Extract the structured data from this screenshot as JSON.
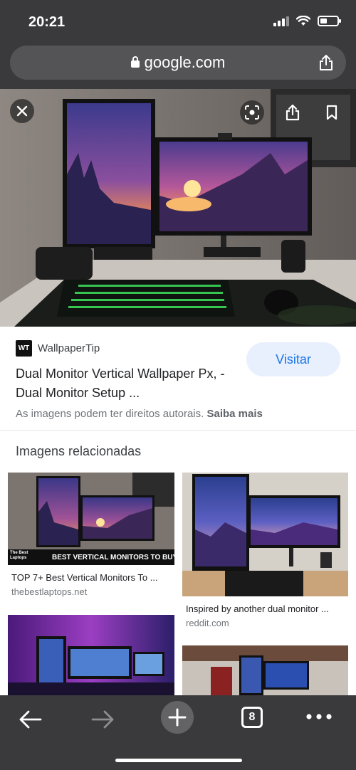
{
  "status_bar": {
    "time": "20:21"
  },
  "browser": {
    "url": "google.com"
  },
  "result": {
    "source_logo_text": "WT",
    "source_name": "WallpaperTip",
    "title": "Dual Monitor Vertical Wallpaper Px, - Dual Monitor Setup ...",
    "visit_label": "Visitar",
    "rights_text": "As imagens podem ter direitos autorais.",
    "learn_more": "Saiba mais"
  },
  "related": {
    "heading": "Imagens relacionadas",
    "items": [
      {
        "title": "TOP 7+ Best Vertical Monitors To ...",
        "source": "thebestlaptops.net",
        "overlay_brand": "The Best Laptops",
        "overlay_text": "BEST VERTICAL MONITORS TO BUY"
      },
      {
        "title": "Inspired by another dual monitor ...",
        "source": "reddit.com"
      }
    ]
  },
  "bottom_bar": {
    "tab_count": "8"
  }
}
